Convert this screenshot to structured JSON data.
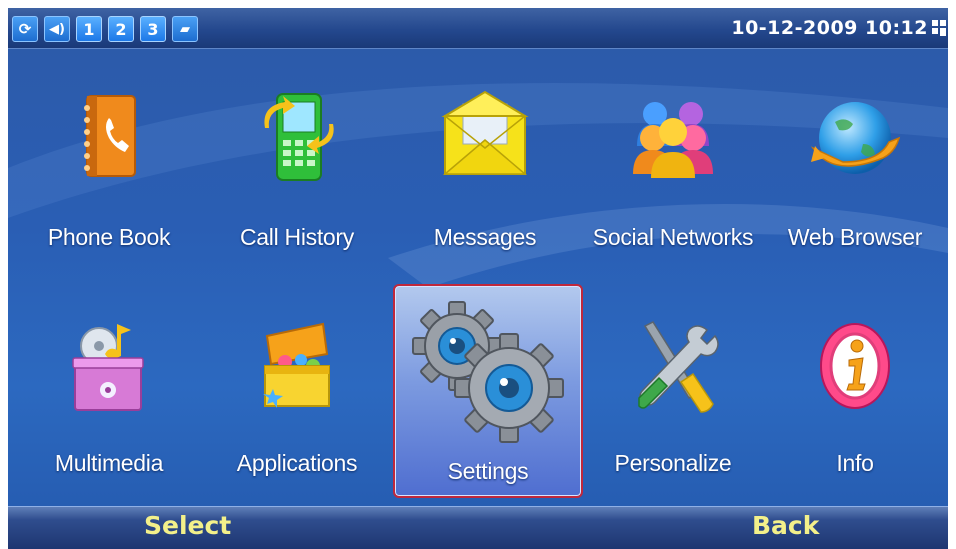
{
  "status_bar": {
    "icons": [
      "sync-icon",
      "sound-icon",
      "profile-1",
      "profile-2",
      "profile-3",
      "sim-card-icon"
    ],
    "profile_numbers": [
      "1",
      "2",
      "3"
    ],
    "datetime": "10-12-2009 10:12"
  },
  "menu": {
    "items": [
      {
        "label": "Phone Book",
        "icon": "phone-book-icon"
      },
      {
        "label": "Call History",
        "icon": "call-history-icon"
      },
      {
        "label": "Messages",
        "icon": "messages-icon"
      },
      {
        "label": "Social Networks",
        "icon": "social-networks-icon"
      },
      {
        "label": "Web Browser",
        "icon": "web-browser-icon"
      },
      {
        "label": "Multimedia",
        "icon": "multimedia-icon"
      },
      {
        "label": "Applications",
        "icon": "applications-icon"
      },
      {
        "label": "Settings",
        "icon": "settings-icon",
        "selected": true
      },
      {
        "label": "Personalize",
        "icon": "personalize-icon"
      },
      {
        "label": "Info",
        "icon": "info-icon"
      }
    ]
  },
  "softkeys": {
    "left": "Select",
    "right": "Back"
  },
  "colors": {
    "background": "#2a5eb4",
    "selection_border": "#c0283c",
    "softkey_text": "#f3f08a"
  }
}
